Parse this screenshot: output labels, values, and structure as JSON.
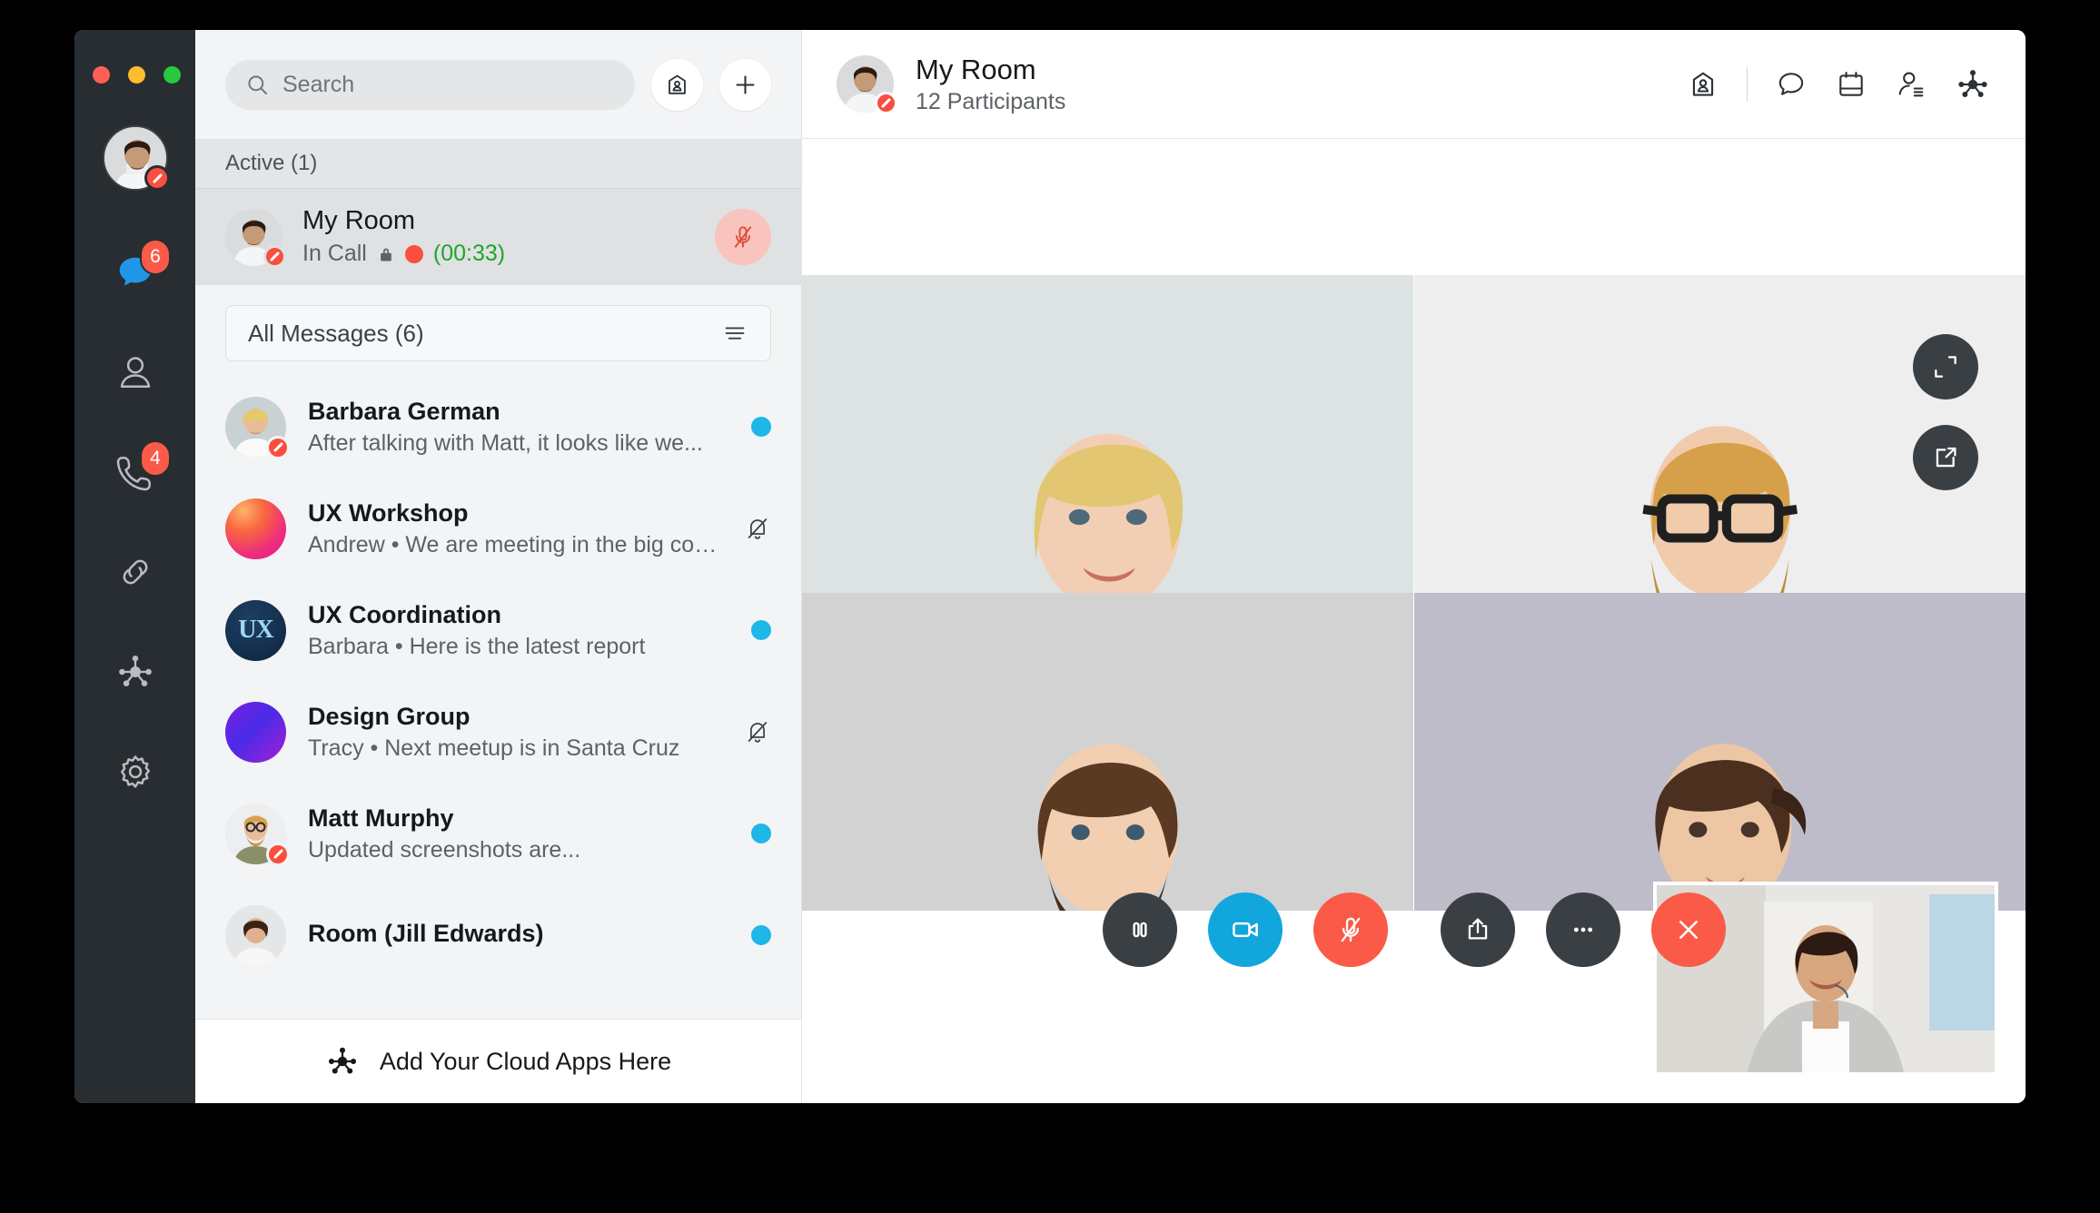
{
  "window": {
    "traffic_lights": [
      "close",
      "minimize",
      "zoom"
    ],
    "colors": {
      "close": "#ff5f57",
      "minimize": "#febc2e",
      "zoom": "#28c840"
    }
  },
  "rail": {
    "avatar": {
      "name": "user-avatar",
      "status": "do-not-disturb"
    },
    "items": [
      {
        "icon": "chat-bubble-icon",
        "label": "Messages",
        "badge": "6",
        "active": true
      },
      {
        "icon": "contacts-person-icon",
        "label": "Contacts",
        "badge": null,
        "active": false
      },
      {
        "icon": "phone-handset-icon",
        "label": "Calls",
        "badge": "4",
        "active": false
      },
      {
        "icon": "link-chain-icon",
        "label": "Links",
        "badge": null,
        "active": false
      },
      {
        "icon": "cloud-apps-hub-icon",
        "label": "Cloud Apps",
        "badge": null,
        "active": false
      },
      {
        "icon": "gear-icon",
        "label": "Settings",
        "badge": null,
        "active": false
      }
    ],
    "accent": "#fa5a47",
    "active_color": "#2196e8"
  },
  "conversations": {
    "search": {
      "placeholder": "Search",
      "value": "",
      "icon": "search-icon"
    },
    "contact_card_button": {
      "icon": "contact-card-icon"
    },
    "add_button": {
      "icon": "plus-icon"
    },
    "section_header": "Active (1)",
    "active_room": {
      "title": "My Room",
      "status_label": "In Call",
      "lock_icon": "lock-icon",
      "recording_dot": true,
      "timer": "(00:33)",
      "timer_color": "#1fa52b",
      "mute_button": {
        "icon": "mic-muted-icon",
        "state": "muted"
      }
    },
    "filter": {
      "label": "All Messages (6)",
      "icon": "filter-lines-icon"
    },
    "items": [
      {
        "name": "Barbara German",
        "preview": "After talking with Matt, it looks like we...",
        "avatar": "photo-barbara",
        "status": "do-not-disturb",
        "unread": true,
        "muted": false
      },
      {
        "name": "UX Workshop",
        "preview": "Andrew • We are meeting in the big conf...",
        "avatar": "gradient-warm",
        "status": null,
        "unread": false,
        "muted": true
      },
      {
        "name": "UX Coordination",
        "preview": "Barbara • Here is the latest report",
        "avatar": "ux-logo",
        "avatar_text": "UX",
        "status": null,
        "unread": true,
        "muted": false
      },
      {
        "name": "Design Group",
        "preview": "Tracy • Next meetup is in Santa Cruz",
        "avatar": "gradient-violet",
        "status": null,
        "unread": false,
        "muted": true
      },
      {
        "name": "Matt Murphy",
        "preview": "Updated screenshots are...",
        "avatar": "photo-matt",
        "status": "do-not-disturb",
        "unread": true,
        "muted": false
      },
      {
        "name": "Room (Jill Edwards)",
        "preview": "",
        "avatar": "photo-jill",
        "status": null,
        "unread": true,
        "muted": false
      }
    ],
    "cloud_apps_bar": {
      "label": "Add Your Cloud Apps Here",
      "icon": "cloud-apps-hub-icon"
    }
  },
  "call": {
    "header": {
      "title": "My Room",
      "subtitle": "12 Participants",
      "avatar_status": "do-not-disturb",
      "icons": [
        {
          "name": "contact-card-icon"
        },
        {
          "name": "chat-bubble-icon"
        },
        {
          "name": "calendar-icon"
        },
        {
          "name": "participants-list-icon"
        },
        {
          "name": "cloud-apps-hub-icon"
        }
      ]
    },
    "float_buttons": [
      {
        "name": "expand-fullscreen-icon"
      },
      {
        "name": "popout-window-icon"
      }
    ],
    "controls": [
      {
        "name": "pause-button",
        "icon": "pause-icon",
        "style": "dark"
      },
      {
        "name": "video-button",
        "icon": "video-camera-icon",
        "style": "blue"
      },
      {
        "name": "mute-button",
        "icon": "mic-muted-icon",
        "style": "red"
      },
      {
        "name": "share-button",
        "icon": "share-upload-icon",
        "style": "dark"
      },
      {
        "name": "more-button",
        "icon": "ellipsis-icon",
        "style": "dark"
      },
      {
        "name": "end-call-button",
        "icon": "close-x-icon",
        "style": "red"
      }
    ],
    "tiles": [
      {
        "participant": "participant-1"
      },
      {
        "participant": "participant-2"
      },
      {
        "participant": "participant-3"
      },
      {
        "participant": "participant-4"
      }
    ],
    "selfview": {
      "name": "self-view"
    }
  }
}
